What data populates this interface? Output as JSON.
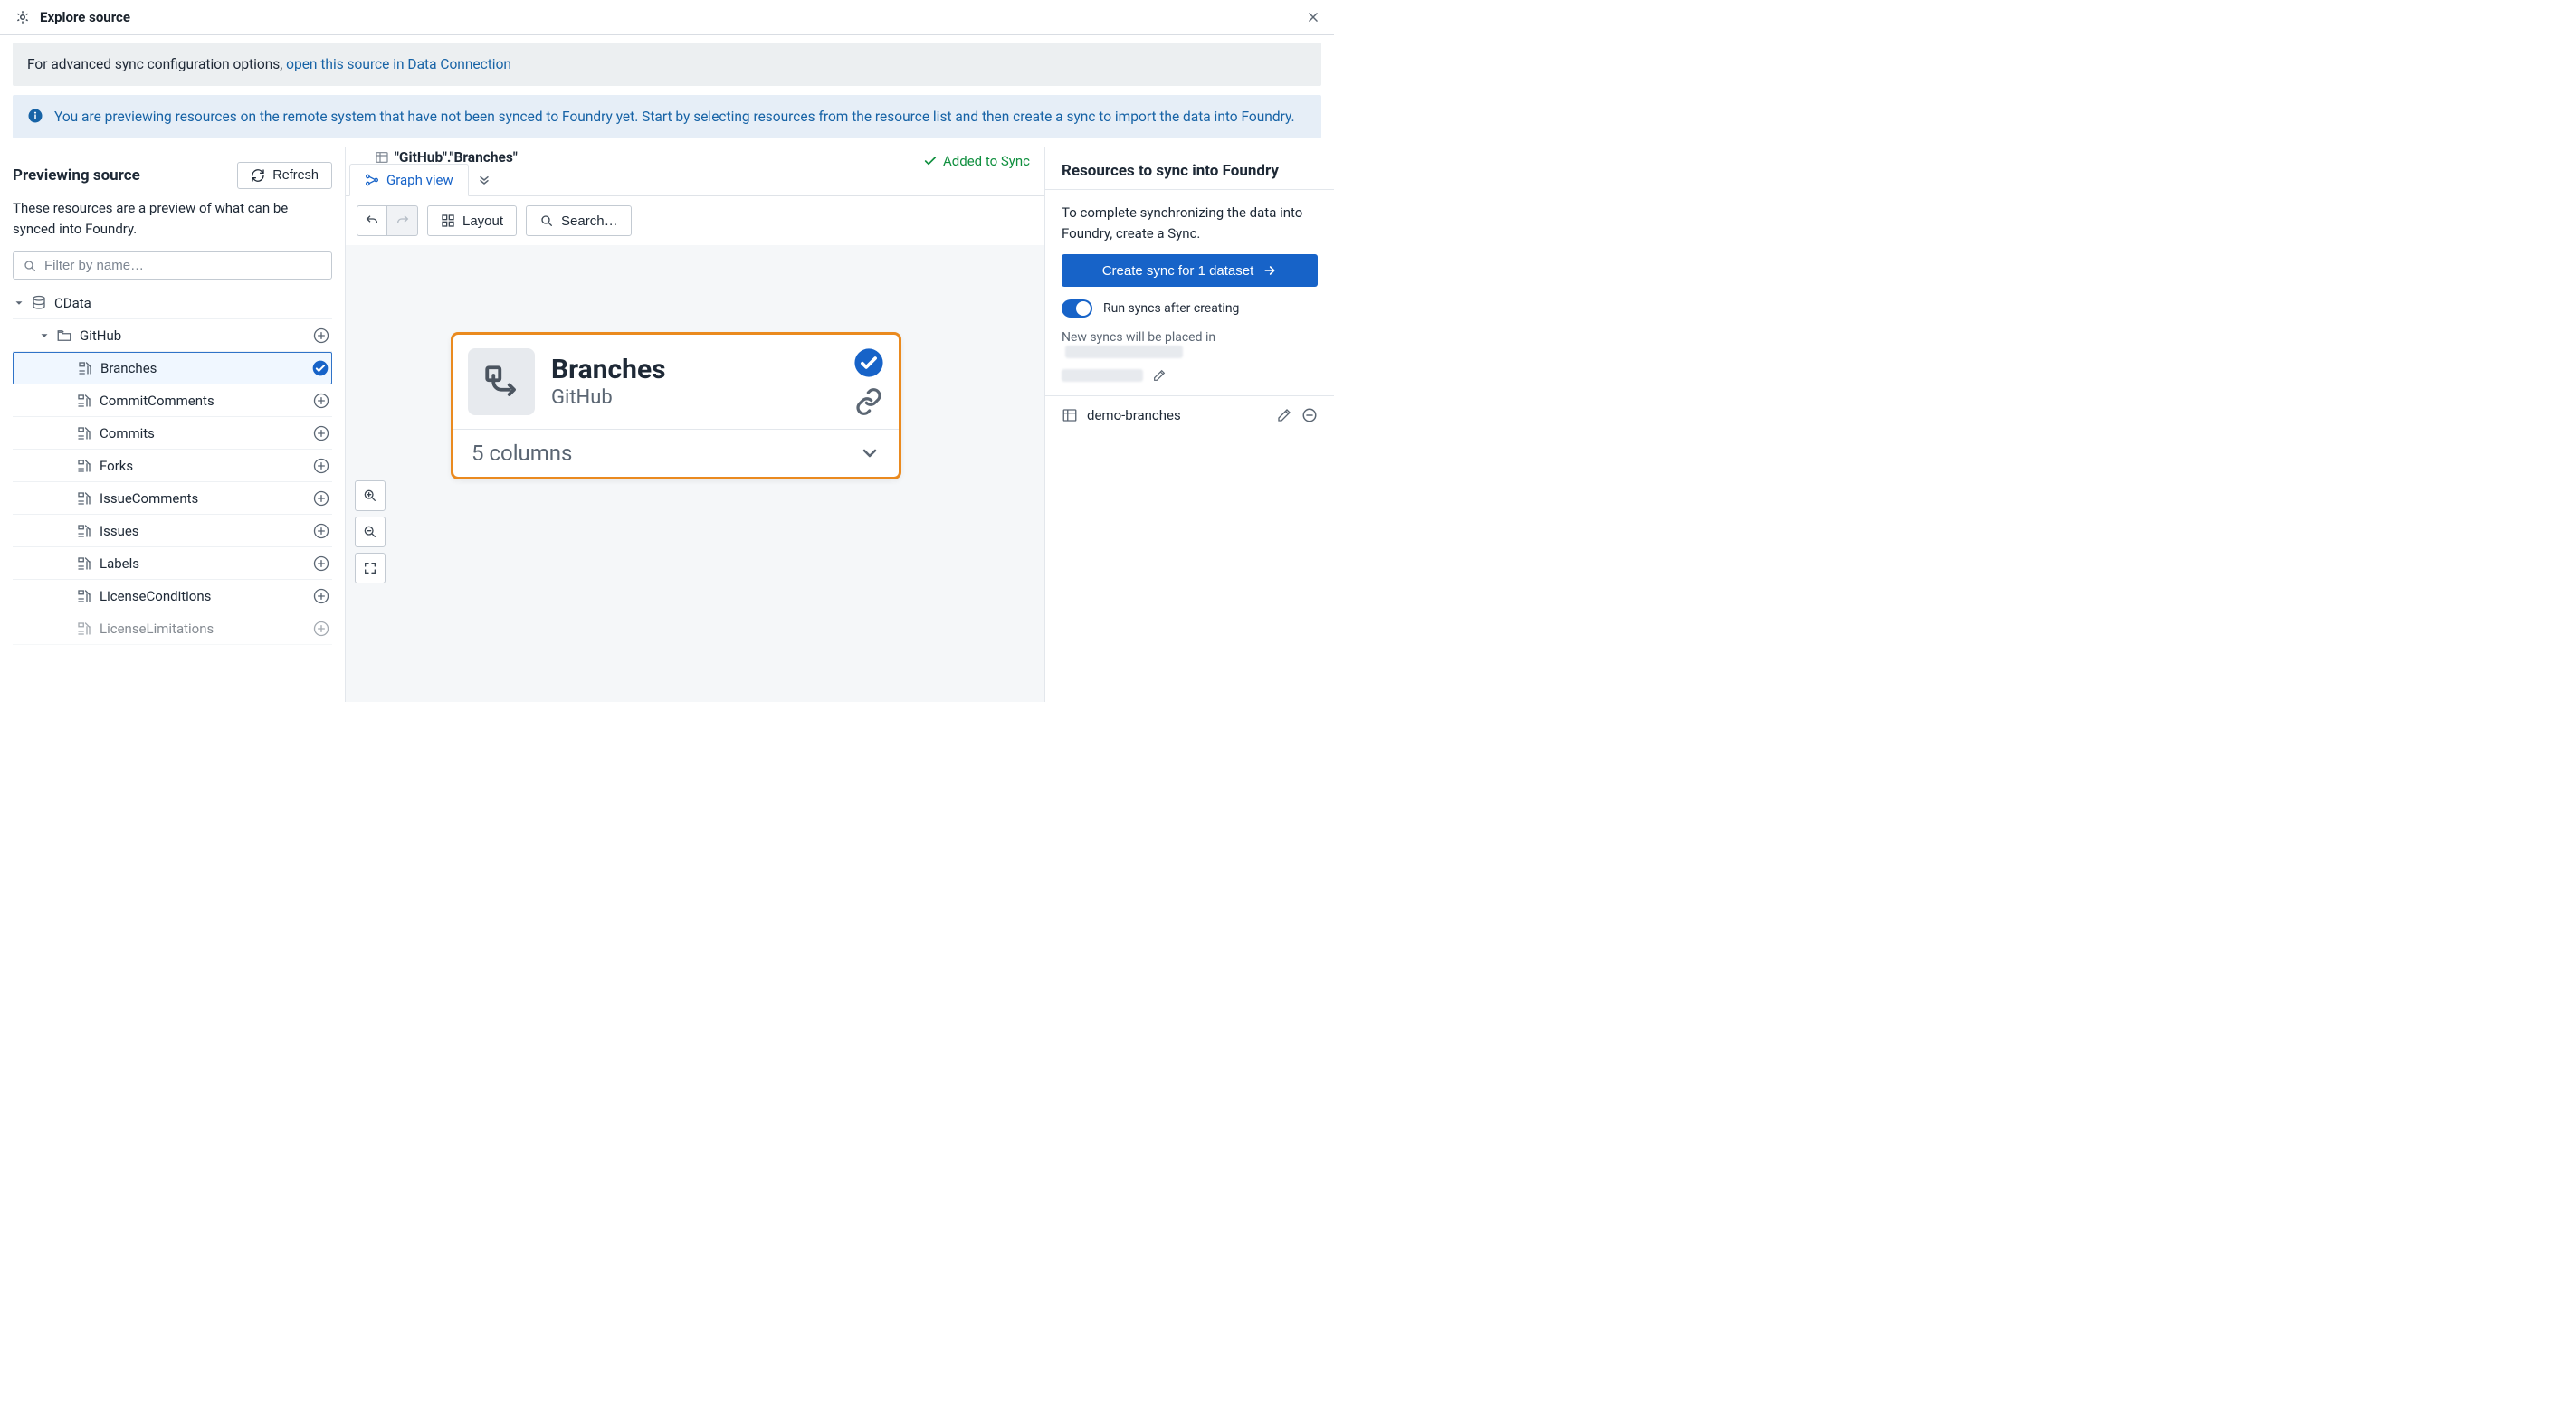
{
  "window": {
    "title": "Explore source"
  },
  "callouts": {
    "advanced_text": "For advanced sync configuration options, ",
    "advanced_link": "open this source in Data Connection",
    "preview_msg": "You are previewing resources on the remote system that have not been synced to Foundry yet. Start by selecting resources from the resource list and then create a sync to import the data into Foundry."
  },
  "left": {
    "heading": "Previewing source",
    "refresh": "Refresh",
    "desc": "These resources are a preview of what can be synced into Foundry.",
    "filter_placeholder": "Filter by name…",
    "root": {
      "label": "CData"
    },
    "folder": {
      "label": "GitHub"
    },
    "items": [
      {
        "label": "Branches",
        "selected": true
      },
      {
        "label": "CommitComments"
      },
      {
        "label": "Commits"
      },
      {
        "label": "Forks"
      },
      {
        "label": "IssueComments"
      },
      {
        "label": "Issues"
      },
      {
        "label": "Labels"
      },
      {
        "label": "LicenseConditions"
      },
      {
        "label": "LicenseLimitations"
      }
    ]
  },
  "center": {
    "crumb": "\"GitHub\".\"Branches\"",
    "sync_badge": "Added to Sync",
    "tab_label": "Graph view",
    "toolbar": {
      "layout": "Layout",
      "search": "Search…"
    },
    "node": {
      "title": "Branches",
      "subtitle": "GitHub",
      "columns": "5 columns"
    }
  },
  "right": {
    "heading": "Resources to sync into Foundry",
    "desc": "To complete synchronizing the data into Foundry, create a Sync.",
    "create_btn": "Create sync for 1 dataset",
    "toggle_label": "Run syncs after creating",
    "placed_in": "New syncs will be placed in",
    "item": "demo-branches"
  }
}
